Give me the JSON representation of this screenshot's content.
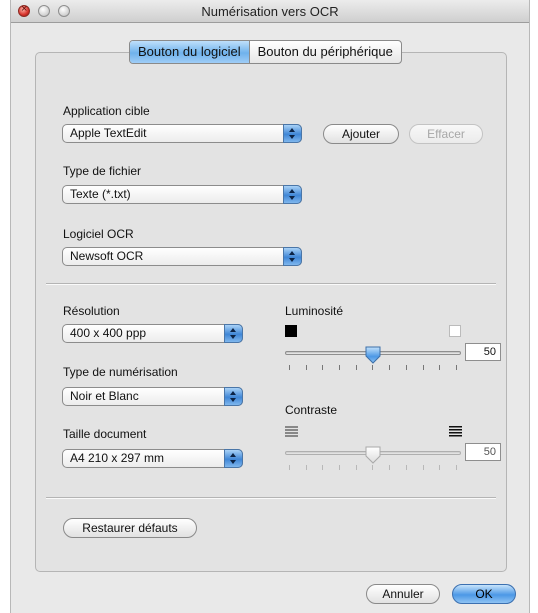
{
  "window": {
    "title": "Numérisation vers OCR"
  },
  "tabs": [
    {
      "label": "Bouton du logiciel",
      "active": true
    },
    {
      "label": "Bouton du périphérique",
      "active": false
    }
  ],
  "application": {
    "label": "Application cible",
    "value": "Apple TextEdit",
    "add_label": "Ajouter",
    "delete_label": "Effacer"
  },
  "file_type": {
    "label": "Type de fichier",
    "value": "Texte (*.txt)"
  },
  "ocr_software": {
    "label": "Logiciel OCR",
    "value": "Newsoft OCR"
  },
  "resolution": {
    "label": "Résolution",
    "value": "400 x 400 ppp"
  },
  "scan_type": {
    "label": "Type de numérisation",
    "value": "Noir et Blanc"
  },
  "document_size": {
    "label": "Taille document",
    "value": "A4 210 x 297 mm"
  },
  "brightness": {
    "label": "Luminosité",
    "value": "50",
    "level": 0.5,
    "enabled": true
  },
  "contrast": {
    "label": "Contraste",
    "value": "50",
    "level": 0.5,
    "enabled": false
  },
  "restore_label": "Restaurer défauts",
  "cancel_label": "Annuler",
  "ok_label": "OK",
  "colors": {
    "accent": "#4c98e6",
    "background": "#e9e9e9"
  },
  "icons": [
    "close-icon",
    "minimize-icon",
    "zoom-icon",
    "popup-arrows-icon",
    "dark-square-icon",
    "light-square-icon",
    "contrast-low-icon",
    "contrast-high-icon"
  ]
}
